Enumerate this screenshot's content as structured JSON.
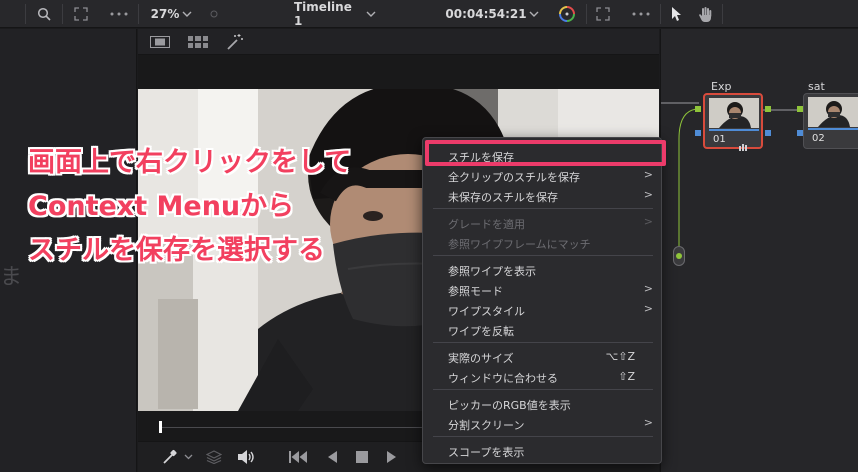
{
  "toolbar": {
    "zoom": "27%",
    "timeline": "Timeline 1",
    "timecode": "00:04:54:21"
  },
  "left_panel": {
    "ghost_text": "ま"
  },
  "nodes": [
    {
      "label": "Exp",
      "number": "01"
    },
    {
      "label": "sat",
      "number": "02"
    }
  ],
  "context_menu": {
    "items": [
      {
        "label": "スチルを保存",
        "shortcut": "",
        "submenu": false,
        "disabled": false
      },
      {
        "label": "全クリップのスチルを保存",
        "shortcut": "",
        "submenu": true,
        "disabled": false
      },
      {
        "label": "未保存のスチルを保存",
        "shortcut": "",
        "submenu": true,
        "disabled": false
      },
      {
        "label": "グレードを適用",
        "shortcut": "",
        "submenu": true,
        "disabled": true
      },
      {
        "label": "参照ワイプフレームにマッチ",
        "shortcut": "",
        "submenu": false,
        "disabled": true
      },
      {
        "label": "参照ワイプを表示",
        "shortcut": "",
        "submenu": false,
        "disabled": false
      },
      {
        "label": "参照モード",
        "shortcut": "",
        "submenu": true,
        "disabled": false
      },
      {
        "label": "ワイプスタイル",
        "shortcut": "",
        "submenu": true,
        "disabled": false
      },
      {
        "label": "ワイプを反転",
        "shortcut": "",
        "submenu": false,
        "disabled": false
      },
      {
        "label": "実際のサイズ",
        "shortcut": "⌥⇧Z",
        "submenu": false,
        "disabled": false
      },
      {
        "label": "ウィンドウに合わせる",
        "shortcut": "⇧Z",
        "submenu": false,
        "disabled": false
      },
      {
        "label": "ピッカーのRGB値を表示",
        "shortcut": "",
        "submenu": false,
        "disabled": false
      },
      {
        "label": "分割スクリーン",
        "shortcut": "",
        "submenu": true,
        "disabled": false
      },
      {
        "label": "スコープを表示",
        "shortcut": "",
        "submenu": false,
        "disabled": false
      }
    ]
  },
  "annotation": {
    "line1": "画面上で右クリックをして",
    "line2": "Context Menuから",
    "line3": "スチルを保存を選択する"
  },
  "colors": {
    "annotation": "#f2405f",
    "highlight_box": "#ec3b6a",
    "node_active_border": "#d84b3c",
    "accent_blue": "#4f8cd6",
    "node_green": "#8fc43a"
  },
  "icons": [
    "search-icon",
    "expand-icon",
    "more-icon",
    "chevron-down-icon",
    "color-wheel-icon",
    "pointer-icon",
    "hand-icon",
    "single-viewer-icon",
    "gallery-icon",
    "magic-wand-icon",
    "eyedropper-icon",
    "layers-icon",
    "speaker-icon",
    "skip-back-icon",
    "play-reverse-icon",
    "stop-icon",
    "play-icon"
  ]
}
